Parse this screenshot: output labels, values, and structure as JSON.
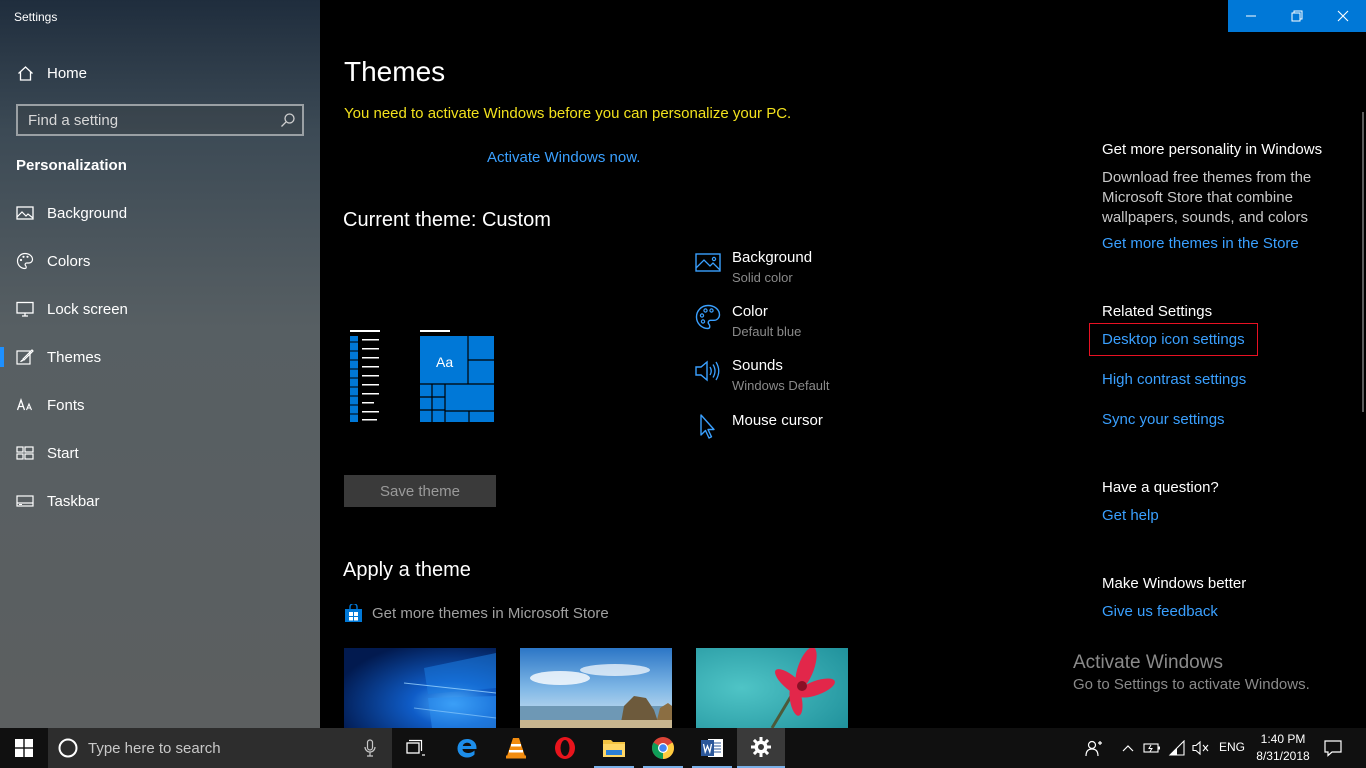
{
  "window": {
    "app_title": "Settings"
  },
  "sidebar": {
    "home_label": "Home",
    "search_placeholder": "Find a setting",
    "section_heading": "Personalization",
    "items": [
      {
        "label": "Background",
        "icon": "picture-icon"
      },
      {
        "label": "Colors",
        "icon": "palette-icon"
      },
      {
        "label": "Lock screen",
        "icon": "monitor-icon"
      },
      {
        "label": "Themes",
        "icon": "brush-icon",
        "active": true
      },
      {
        "label": "Fonts",
        "icon": "font-icon"
      },
      {
        "label": "Start",
        "icon": "start-tiles-icon"
      },
      {
        "label": "Taskbar",
        "icon": "taskbar-icon"
      }
    ]
  },
  "main": {
    "title": "Themes",
    "activation_warning": "You need to activate Windows before you can personalize your PC.",
    "activate_link": "Activate Windows now.",
    "current_theme": "Current theme: Custom",
    "preview_text": "Aa",
    "properties": [
      {
        "title": "Background",
        "subtitle": "Solid color",
        "icon": "picture-icon"
      },
      {
        "title": "Color",
        "subtitle": "Default blue",
        "icon": "palette-icon"
      },
      {
        "title": "Sounds",
        "subtitle": "Windows Default",
        "icon": "speaker-icon"
      },
      {
        "title": "Mouse cursor",
        "subtitle": "",
        "icon": "cursor-icon"
      }
    ],
    "save_theme_label": "Save theme",
    "apply_heading": "Apply a theme",
    "store_link": "Get more themes in Microsoft Store"
  },
  "right": {
    "personality_heading": "Get more personality in Windows",
    "personality_text": "Download free themes from the Microsoft Store that combine wallpapers, sounds, and colors",
    "store_link": "Get more themes in the Store",
    "related_heading": "Related Settings",
    "related_links": [
      "Desktop icon settings",
      "High contrast settings",
      "Sync your settings"
    ],
    "question_heading": "Have a question?",
    "help_link": "Get help",
    "better_heading": "Make Windows better",
    "feedback_link": "Give us feedback"
  },
  "watermark": {
    "title": "Activate Windows",
    "subtitle": "Go to Settings to activate Windows."
  },
  "taskbar": {
    "search_placeholder": "Type here to search",
    "language": "ENG",
    "time": "1:40 PM",
    "date": "8/31/2018"
  },
  "colors": {
    "accent": "#0078d7",
    "link": "#3aa0ff",
    "warning": "#f2e11d",
    "highlight_box": "#e81123"
  }
}
